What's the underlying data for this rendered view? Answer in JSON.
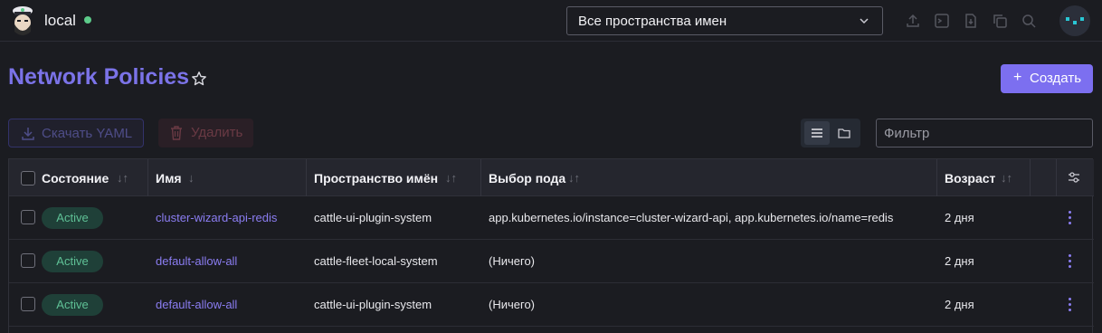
{
  "header": {
    "cluster_name": "local",
    "namespace_select": {
      "value": "Все пространства имен"
    },
    "icons": [
      "upload-icon",
      "terminal-icon",
      "download-file-icon",
      "copy-icon",
      "search-icon"
    ]
  },
  "page": {
    "title": "Network Policies",
    "create_label": "Создать"
  },
  "toolbar": {
    "download_yaml_label": "Скачать YAML",
    "delete_label": "Удалить",
    "filter_placeholder": "Фильтр"
  },
  "table": {
    "columns": [
      "Состояние",
      "Имя",
      "Пространство имён",
      "Выбор пода",
      "Возраст"
    ],
    "rows": [
      {
        "state": "Active",
        "name": "cluster-wizard-api-redis",
        "namespace": "cattle-ui-plugin-system",
        "pod_selector": "app.kubernetes.io/instance=cluster-wizard-api, app.kubernetes.io/name=redis",
        "age": "2 дня"
      },
      {
        "state": "Active",
        "name": "default-allow-all",
        "namespace": "cattle-fleet-local-system",
        "pod_selector": "(Ничего)",
        "age": "2 дня"
      },
      {
        "state": "Active",
        "name": "default-allow-all",
        "namespace": "cattle-ui-plugin-system",
        "pod_selector": "(Ничего)",
        "age": "2 дня"
      }
    ]
  },
  "colors": {
    "accent": "#7c6ff0",
    "status_active": "#5fc196",
    "status_online": "#5dcb8a"
  }
}
